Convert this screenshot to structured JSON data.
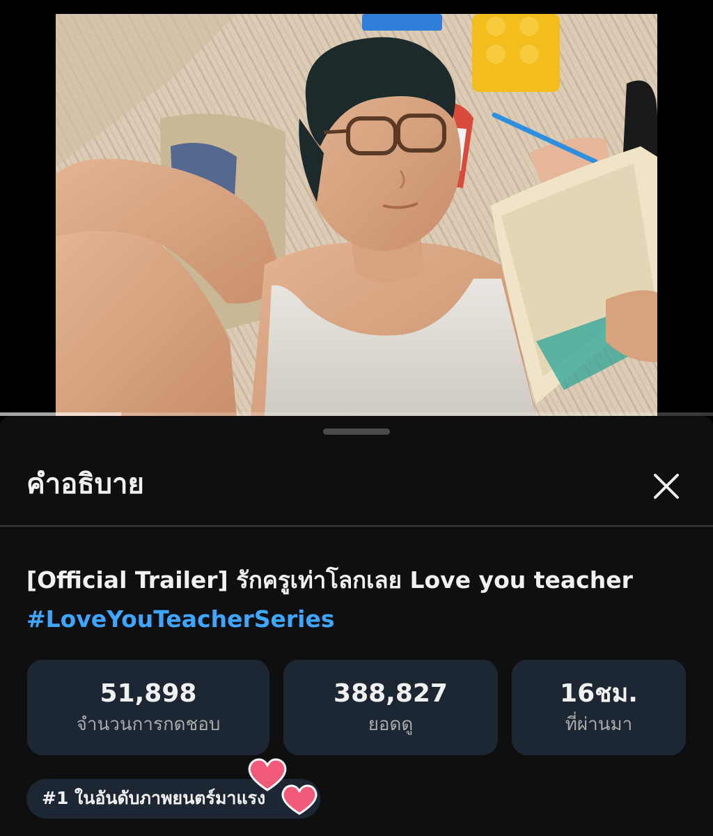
{
  "player": {
    "progress_fraction": 0.17
  },
  "description_panel": {
    "title": "คำอธิบาย",
    "close_icon": "close-icon"
  },
  "video": {
    "title_line1": "[Official Trailer] รักครูเท่าโลกเลย Love you teacher",
    "hashtag": "#LoveYouTeacherSeries"
  },
  "stats": {
    "likes_value": "51,898",
    "likes_label": "จำนวนการกดชอบ",
    "views_value": "388,827",
    "views_label": "ยอดดู",
    "time_value": "16ชม.",
    "time_label": "ที่ผ่านมา"
  },
  "trending": {
    "label": "#1 ในอันดับภาพยนตร์มาแรง"
  },
  "colors": {
    "accent_link": "#3ea6ff",
    "card_bg": "#1c2733",
    "sheet_bg": "#0f0f0f",
    "heart": "#f25a7a"
  }
}
